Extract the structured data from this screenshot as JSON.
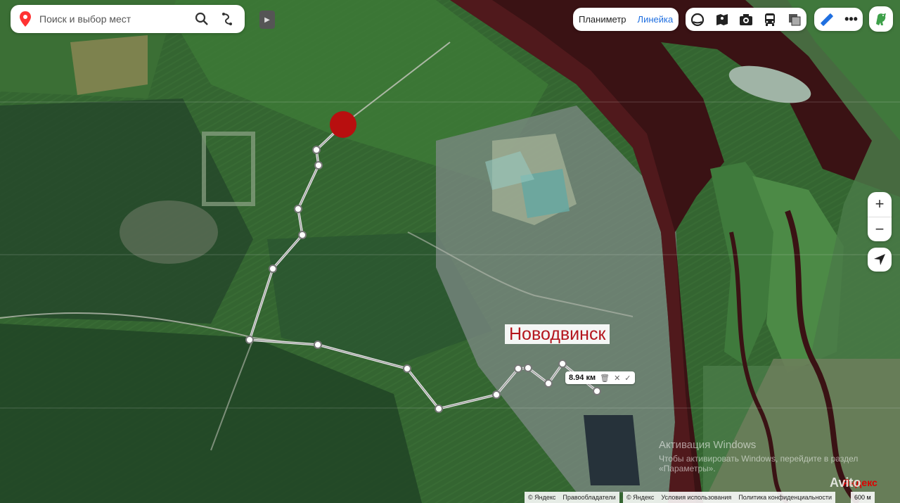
{
  "search": {
    "placeholder": "Поиск и выбор мест"
  },
  "tools": {
    "planimeter": "Планиметр",
    "ruler": "Линейка"
  },
  "map": {
    "city_label": "Новодвинск",
    "route_distance": "8.94 км",
    "watermark_line1": "Активация Windows",
    "watermark_line2": "Чтобы активировать Windows, перейдите в раздел «Параметры».",
    "avito": "Avito"
  },
  "footer": {
    "copyright1": "© Яндекс",
    "rights_holders": "Правообладатели",
    "copyright2": "© Яндекс",
    "terms": "Условия использования",
    "privacy": "Политика конфиденциальности",
    "scale": "600 м",
    "brand": "Яндекс"
  },
  "icons": [
    "pin-icon",
    "search-icon",
    "route-icon",
    "collapse-icon",
    "panorama-icon",
    "streetview-icon",
    "camera-icon",
    "transit-icon",
    "layers-icon",
    "ruler-icon",
    "more-icon",
    "dino-icon",
    "zoom-in-icon",
    "zoom-out-icon",
    "geolocation-icon",
    "delete-icon",
    "close-icon",
    "check-icon"
  ],
  "colors": {
    "accent": "#1f6fe0",
    "city_text": "#b4151d",
    "marker": "#b80f0f",
    "route": "#dcdcdc"
  }
}
